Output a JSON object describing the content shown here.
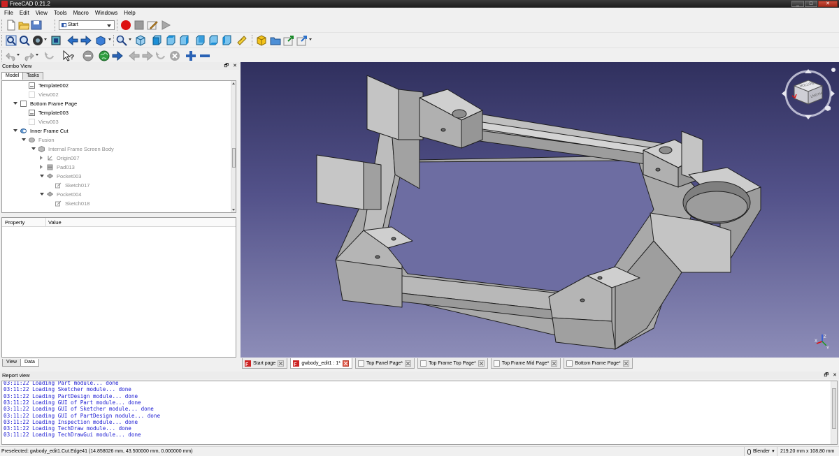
{
  "window": {
    "title": "FreeCAD 0.21.2",
    "buttons": [
      "_",
      "□",
      "✕"
    ]
  },
  "menu": [
    "File",
    "Edit",
    "View",
    "Tools",
    "Macro",
    "Windows",
    "Help"
  ],
  "toolbar": {
    "workbench": "Start"
  },
  "combo_view": {
    "title": "Combo View",
    "tabs": [
      "Model",
      "Tasks"
    ],
    "bottom_tabs": [
      "View",
      "Data"
    ],
    "property_header": {
      "property": "Property",
      "value": "Value"
    },
    "tree": [
      {
        "label": "Template002",
        "icon": "template-icon",
        "dim": false
      },
      {
        "label": "View002",
        "icon": "drawing-view-icon",
        "dim": true
      },
      {
        "label": "Bottom Frame Page",
        "icon": "page-icon",
        "dim": false
      },
      {
        "label": "Template003",
        "icon": "template-icon",
        "dim": false
      },
      {
        "label": "View003",
        "icon": "drawing-view-icon",
        "dim": true
      },
      {
        "label": "Inner Frame Cut",
        "icon": "cut-icon",
        "dim": false
      },
      {
        "label": "Fusion",
        "icon": "fusion-icon",
        "dim": true
      },
      {
        "label": "Internal Frame Screen Body",
        "icon": "body-icon",
        "dim": true
      },
      {
        "label": "Origin007",
        "icon": "origin-icon",
        "dim": true
      },
      {
        "label": "Pad013",
        "icon": "pad-icon",
        "dim": true
      },
      {
        "label": "Pocket003",
        "icon": "pocket-icon",
        "dim": true
      },
      {
        "label": "Sketch017",
        "icon": "sketch-icon",
        "dim": true
      },
      {
        "label": "Pocket004",
        "icon": "pocket-icon",
        "dim": true
      },
      {
        "label": "Sketch018",
        "icon": "sketch-icon",
        "dim": true
      }
    ]
  },
  "nav_cube": {
    "top": "HOLLOW",
    "front": "LNGTH"
  },
  "doc_tabs": [
    {
      "label": "Start page",
      "active": false
    },
    {
      "label": "gwbody_edit1 : 1*",
      "active": true
    },
    {
      "label": "Top Panel Page*",
      "active": false
    },
    {
      "label": "Top Frame Top Page*",
      "active": false
    },
    {
      "label": "Top Frame Mid Page*",
      "active": false
    },
    {
      "label": "Bottom Frame Page*",
      "active": false
    }
  ],
  "report_view": {
    "title": "Report view",
    "lines": [
      "03:11:22  Loading Part module... done",
      "03:11:22  Loading Sketcher module... done",
      "03:11:22  Loading PartDesign module... done",
      "03:11:22  Loading GUI of Part module... done",
      "03:11:22  Loading GUI of Sketcher module... done",
      "03:11:22  Loading GUI of PartDesign module... done",
      "03:11:22  Loading Inspection module... done",
      "03:11:22  Loading TechDraw module... done",
      "03:11:22  Loading TechDrawGui module... done"
    ]
  },
  "status": {
    "preselected": "Preselected: gwbody_edit1.Cut.Edge41 (14.858026 mm, 43.500000 mm, 0.000000 mm)",
    "navigation": "Blender",
    "dimensions": "219,20 mm x 108,80 mm"
  },
  "axis_labels": {
    "x": "X",
    "y": "Y",
    "z": "Z"
  },
  "colors": {
    "model_face": "#b4b4b4",
    "model_edge": "#1e1e1e",
    "bg_top": "#30305e",
    "bg_bottom": "#8d8db8",
    "active_tab_close": "#e35b4b"
  }
}
